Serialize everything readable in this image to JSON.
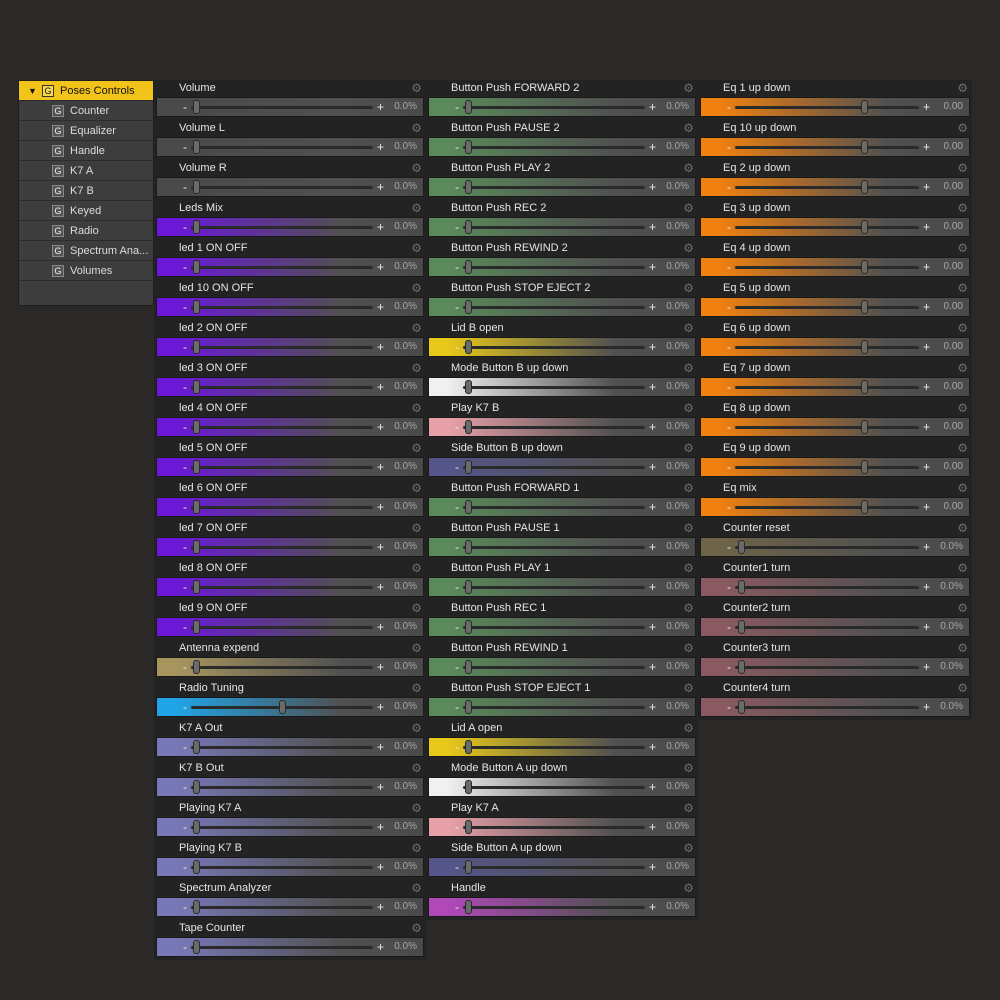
{
  "tree": {
    "root": {
      "label": "Poses Controls",
      "badge": "G"
    },
    "children": [
      {
        "label": "Counter",
        "badge": "G"
      },
      {
        "label": "Equalizer",
        "badge": "G"
      },
      {
        "label": "Handle",
        "badge": "G"
      },
      {
        "label": "K7 A",
        "badge": "G"
      },
      {
        "label": "K7 B",
        "badge": "G"
      },
      {
        "label": "Keyed",
        "badge": "G"
      },
      {
        "label": "Radio",
        "badge": "G"
      },
      {
        "label": "Spectrum Ana...",
        "badge": "G"
      },
      {
        "label": "Volumes",
        "badge": "G"
      }
    ]
  },
  "colors": {
    "gray": "#4a4a4a",
    "purple": "#6b18d8",
    "khaki": "#a8955e",
    "cyan": "#20a4e6",
    "lavender": "#7878b8",
    "green": "#5a8a5a",
    "yellow": "#e8c81a",
    "white": "#f0f0f0",
    "pink": "#e8a0a8",
    "slate": "#55558a",
    "magenta": "#b048b8",
    "orange": "#f08010",
    "olive": "#6e6448",
    "rose": "#8a5a62"
  },
  "icons": {
    "gear": "gear-icon",
    "expand": "triangle-down-icon"
  },
  "columns": [
    {
      "controls": [
        {
          "name": "Volume",
          "value": "0.0%",
          "color": "gray",
          "pos": 0.03
        },
        {
          "name": "Volume L",
          "value": "0.0%",
          "color": "gray",
          "pos": 0.03
        },
        {
          "name": "Volume R",
          "value": "0.0%",
          "color": "gray",
          "pos": 0.03
        },
        {
          "name": "Leds Mix",
          "value": "0.0%",
          "color": "purple",
          "pos": 0.03
        },
        {
          "name": "led 1 ON OFF",
          "value": "0.0%",
          "color": "purple",
          "pos": 0.03
        },
        {
          "name": "led 10 ON OFF",
          "value": "0.0%",
          "color": "purple",
          "pos": 0.03
        },
        {
          "name": "led 2 ON OFF",
          "value": "0.0%",
          "color": "purple",
          "pos": 0.03
        },
        {
          "name": "led 3 ON OFF",
          "value": "0.0%",
          "color": "purple",
          "pos": 0.03
        },
        {
          "name": "led 4 ON OFF",
          "value": "0.0%",
          "color": "purple",
          "pos": 0.03
        },
        {
          "name": "led 5 ON OFF",
          "value": "0.0%",
          "color": "purple",
          "pos": 0.03
        },
        {
          "name": "led 6 ON OFF",
          "value": "0.0%",
          "color": "purple",
          "pos": 0.03
        },
        {
          "name": "led 7 ON OFF",
          "value": "0.0%",
          "color": "purple",
          "pos": 0.03
        },
        {
          "name": "led 8 ON OFF",
          "value": "0.0%",
          "color": "purple",
          "pos": 0.03
        },
        {
          "name": "led 9 ON OFF",
          "value": "0.0%",
          "color": "purple",
          "pos": 0.03
        },
        {
          "name": "Antenna expend",
          "value": "0.0%",
          "color": "khaki",
          "pos": 0.03
        },
        {
          "name": "Radio Tuning",
          "value": "0.0%",
          "color": "cyan",
          "pos": 0.5
        },
        {
          "name": "K7 A Out",
          "value": "0.0%",
          "color": "lavender",
          "pos": 0.03
        },
        {
          "name": "K7 B Out",
          "value": "0.0%",
          "color": "lavender",
          "pos": 0.03
        },
        {
          "name": "Playing K7 A",
          "value": "0.0%",
          "color": "lavender",
          "pos": 0.03
        },
        {
          "name": "Playing K7 B",
          "value": "0.0%",
          "color": "lavender",
          "pos": 0.03
        },
        {
          "name": "Spectrum Analyzer",
          "value": "0.0%",
          "color": "lavender",
          "pos": 0.03
        },
        {
          "name": "Tape Counter",
          "value": "0.0%",
          "color": "lavender",
          "pos": 0.03
        }
      ]
    },
    {
      "controls": [
        {
          "name": "Button Push FORWARD 2",
          "value": "0.0%",
          "color": "green",
          "pos": 0.03
        },
        {
          "name": "Button Push PAUSE 2",
          "value": "0.0%",
          "color": "green",
          "pos": 0.03
        },
        {
          "name": "Button Push PLAY 2",
          "value": "0.0%",
          "color": "green",
          "pos": 0.03
        },
        {
          "name": "Button Push REC 2",
          "value": "0.0%",
          "color": "green",
          "pos": 0.03
        },
        {
          "name": "Button Push REWIND 2",
          "value": "0.0%",
          "color": "green",
          "pos": 0.03
        },
        {
          "name": "Button Push STOP EJECT 2",
          "value": "0.0%",
          "color": "green",
          "pos": 0.03
        },
        {
          "name": "Lid B open",
          "value": "0.0%",
          "color": "yellow",
          "pos": 0.03
        },
        {
          "name": "Mode Button B up down",
          "value": "0.0%",
          "color": "white",
          "pos": 0.03
        },
        {
          "name": "Play K7 B",
          "value": "0.0%",
          "color": "pink",
          "pos": 0.03
        },
        {
          "name": "Side Button B up down",
          "value": "0.0%",
          "color": "slate",
          "pos": 0.03
        },
        {
          "name": "Button Push FORWARD 1",
          "value": "0.0%",
          "color": "green",
          "pos": 0.03
        },
        {
          "name": "Button Push PAUSE 1",
          "value": "0.0%",
          "color": "green",
          "pos": 0.03
        },
        {
          "name": "Button Push PLAY 1",
          "value": "0.0%",
          "color": "green",
          "pos": 0.03
        },
        {
          "name": "Button Push REC 1",
          "value": "0.0%",
          "color": "green",
          "pos": 0.03
        },
        {
          "name": "Button Push REWIND 1",
          "value": "0.0%",
          "color": "green",
          "pos": 0.03
        },
        {
          "name": "Button Push STOP EJECT 1",
          "value": "0.0%",
          "color": "green",
          "pos": 0.03
        },
        {
          "name": "Lid A open",
          "value": "0.0%",
          "color": "yellow",
          "pos": 0.03
        },
        {
          "name": "Mode Button A up down",
          "value": "0.0%",
          "color": "white",
          "pos": 0.03
        },
        {
          "name": "Play K7 A",
          "value": "0.0%",
          "color": "pink",
          "pos": 0.03
        },
        {
          "name": "Side Button A up down",
          "value": "0.0%",
          "color": "slate",
          "pos": 0.03
        },
        {
          "name": "Handle",
          "value": "0.0%",
          "color": "magenta",
          "pos": 0.03
        }
      ]
    },
    {
      "controls": [
        {
          "name": "Eq 1 up down",
          "value": "0.00",
          "color": "orange",
          "pos": 0.7
        },
        {
          "name": "Eq 10 up down",
          "value": "0.00",
          "color": "orange",
          "pos": 0.7
        },
        {
          "name": "Eq 2 up down",
          "value": "0.00",
          "color": "orange",
          "pos": 0.7
        },
        {
          "name": "Eq 3 up down",
          "value": "0.00",
          "color": "orange",
          "pos": 0.7
        },
        {
          "name": "Eq 4 up down",
          "value": "0.00",
          "color": "orange",
          "pos": 0.7
        },
        {
          "name": "Eq 5 up down",
          "value": "0.00",
          "color": "orange",
          "pos": 0.7
        },
        {
          "name": "Eq 6 up down",
          "value": "0.00",
          "color": "orange",
          "pos": 0.7
        },
        {
          "name": "Eq 7 up down",
          "value": "0.00",
          "color": "orange",
          "pos": 0.7
        },
        {
          "name": "Eq 8 up down",
          "value": "0.00",
          "color": "orange",
          "pos": 0.7
        },
        {
          "name": "Eq 9 up down",
          "value": "0.00",
          "color": "orange",
          "pos": 0.7
        },
        {
          "name": "Eq mix",
          "value": "0.00",
          "color": "orange",
          "pos": 0.7
        },
        {
          "name": "Counter reset",
          "value": "0.0%",
          "color": "olive",
          "pos": 0.03
        },
        {
          "name": "Counter1 turn",
          "value": "0.0%",
          "color": "rose",
          "pos": 0.03
        },
        {
          "name": "Counter2 turn",
          "value": "0.0%",
          "color": "rose",
          "pos": 0.03
        },
        {
          "name": "Counter3 turn",
          "value": "0.0%",
          "color": "rose",
          "pos": 0.03
        },
        {
          "name": "Counter4 turn",
          "value": "0.0%",
          "color": "rose",
          "pos": 0.03
        }
      ]
    }
  ]
}
